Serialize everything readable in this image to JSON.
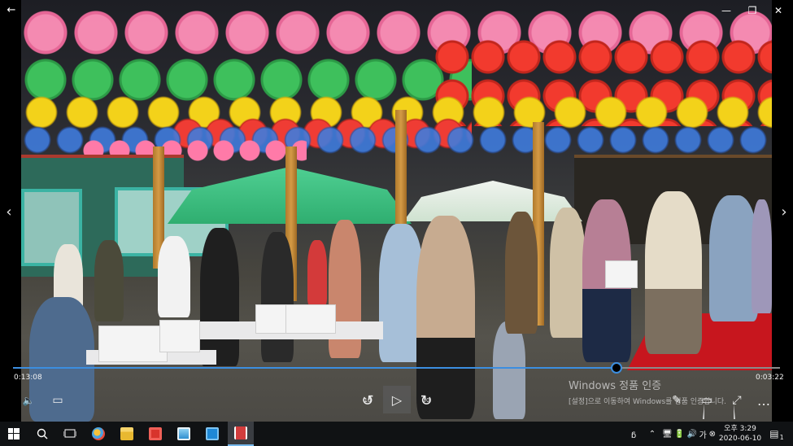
{
  "player": {
    "time_elapsed": "0:13:08",
    "time_total": "0:03:22",
    "progress": 0.787
  },
  "icons": {
    "back": "←",
    "minimize": "—",
    "restore": "❐",
    "close": "✕",
    "prev": "‹",
    "next": "›",
    "volume": "🔈",
    "captions": "▭",
    "rewind": "↺",
    "rewind_num": "10",
    "play": "▷",
    "forward": "↻",
    "forward_num": "30",
    "edit": "✎",
    "cast": "▭",
    "fullscreen": "⤢",
    "more": "…"
  },
  "watermark": {
    "title": "Windows 정품 인증",
    "subtitle": "[설정]으로 이동하여 Windows를 정품 인증합니다."
  },
  "taskbar": {
    "clock_time": "오후 3:29",
    "clock_date": "2020-06-10",
    "notif_count": "1",
    "tray_icons": [
      "ᵷ",
      "⌃",
      "🖥",
      "🔋",
      "🔊",
      "가",
      "⊗"
    ]
  },
  "colors": {
    "accent": "#3c8ee0",
    "taskbar": "#101214"
  }
}
